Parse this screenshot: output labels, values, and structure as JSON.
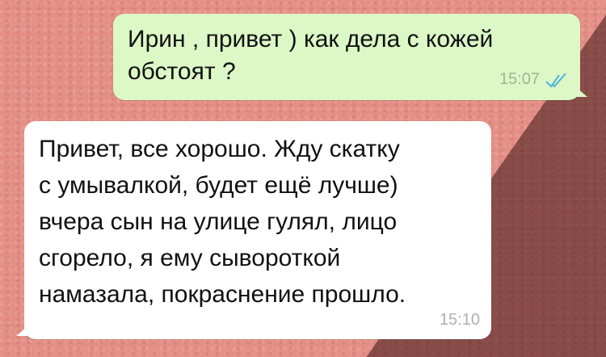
{
  "messages": [
    {
      "direction": "outgoing",
      "text": "Ирин , привет ) как дела с кожей\nобстоят ?",
      "time": "15:07",
      "status_icon": "double-check-read-icon",
      "bubble_color": "#dcf8c6",
      "tick_color": "#4fb3e0"
    },
    {
      "direction": "incoming",
      "text": "Привет, все хорошо. Жду скатку\nс умывалкой, будет ещё лучше)\nвчера сын на улице гулял, лицо\nсгорело, я ему сывороткой\nнамазала, покраснение прошло.",
      "time": "15:10",
      "bubble_color": "#ffffff"
    }
  ],
  "background_color": "#e48e86"
}
